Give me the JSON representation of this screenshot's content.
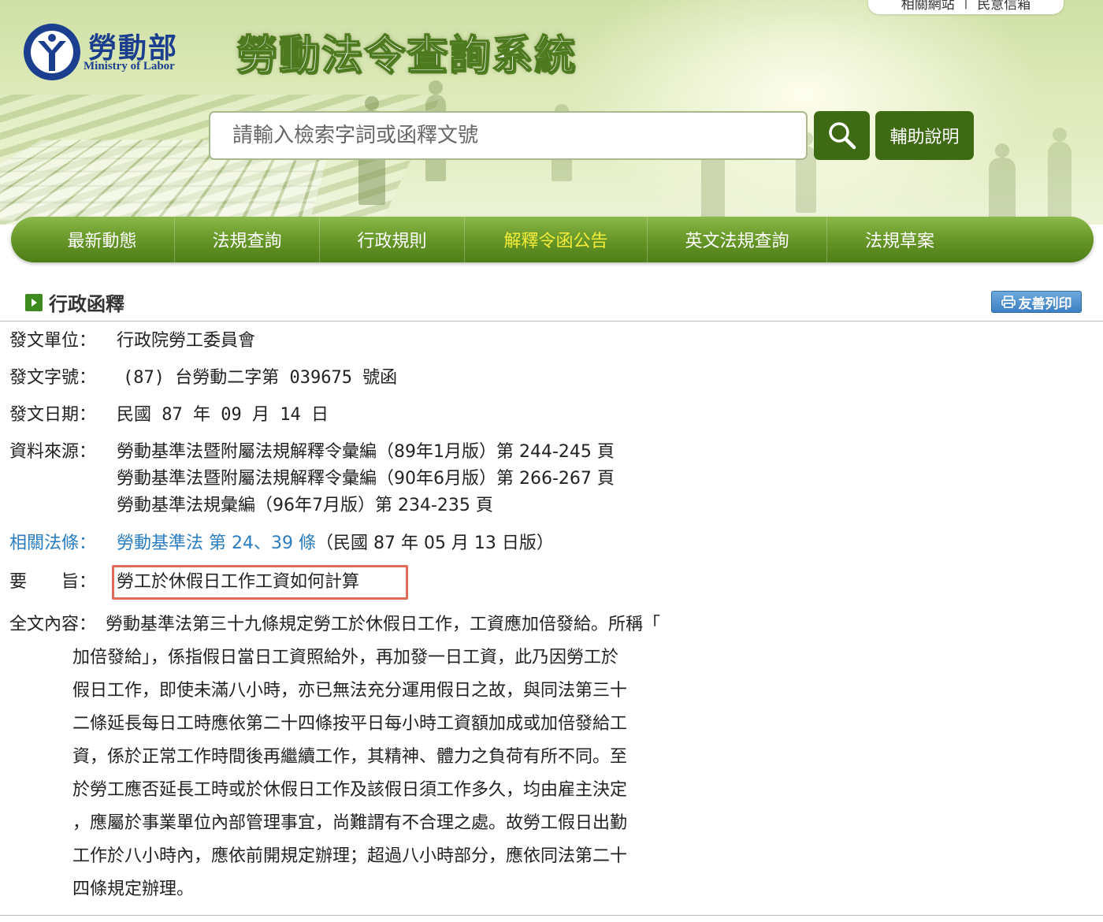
{
  "header": {
    "top_links": [
      "相關網站",
      "民意信箱"
    ],
    "top_separator": "|",
    "logo_cn": "勞動部",
    "logo_en": "Ministry of Labor",
    "site_title": "勞動法令查詢系統",
    "search_placeholder": "請輸入檢索字詞或函釋文號",
    "help_label": "輔助說明"
  },
  "nav": {
    "items": [
      "最新動態",
      "法規查詢",
      "行政規則",
      "解釋令函公告",
      "英文法規查詢",
      "法規草案"
    ],
    "active_index": 3
  },
  "section": {
    "title": "行政函釋",
    "print_label": "友善列印"
  },
  "fields": {
    "unit_label": "發文單位：",
    "unit_value": "行政院勞工委員會",
    "number_label": "發文字號：",
    "number_value": "(87) 台勞動二字第 039675 號函",
    "date_label": "發文日期：",
    "date_value": "民國 87 年 09 月 14 日",
    "source_label": "資料來源：",
    "source_values": [
      "勞動基準法暨附屬法規解釋令彙編（89年1月版）第 244-245 頁",
      "勞動基準法暨附屬法規解釋令彙編（90年6月版）第 266-267 頁",
      "勞動基準法規彙編（96年7月版）第 234-235 頁"
    ],
    "law_label": "相關法條：",
    "law_link": "勞動基準法 第 24、39 條",
    "law_version": "（民國 87 年 05 月 13 日版）",
    "summary_label": "要　　旨：",
    "summary_value": "勞工於休假日工作工資如何計算",
    "fulltext_label": "全文內容：",
    "fulltext_lines": [
      "勞動基準法第三十九條規定勞工於休假日工作，工資應加倍發給。所稱「",
      "加倍發給」，係指假日當日工資照給外，再加發一日工資，此乃因勞工於",
      "假日工作，即使未滿八小時，亦已無法充分運用假日之故，與同法第三十",
      "二條延長每日工時應依第二十四條按平日每小時工資額加成或加倍發給工",
      "資，係於正常工作時間後再繼續工作，其精神、體力之負荷有所不同。至",
      "於勞工應否延長工時或於休假日工作及該假日須工作多久，均由雇主決定",
      "，應屬於事業單位內部管理事宜，尚難謂有不合理之處。故勞工假日出勤",
      "工作於八小時內，應依前開規定辦理；超過八小時部分，應依同法第二十",
      "四條規定辦理。"
    ]
  },
  "colors": {
    "nav_green": "#5f8f22",
    "nav_active_text": "#f4ec3a",
    "button_green": "#3f6a14",
    "link_blue": "#2a7dc1",
    "highlight_red": "#e26a5a",
    "logo_blue": "#1b3f8e",
    "print_blue": "#3d80c4"
  },
  "icons": {
    "search_button": "magnifier-icon",
    "section_heading": "arrow-right-icon",
    "print_button": "printer-icon",
    "logo": "ministry-logo-icon"
  }
}
